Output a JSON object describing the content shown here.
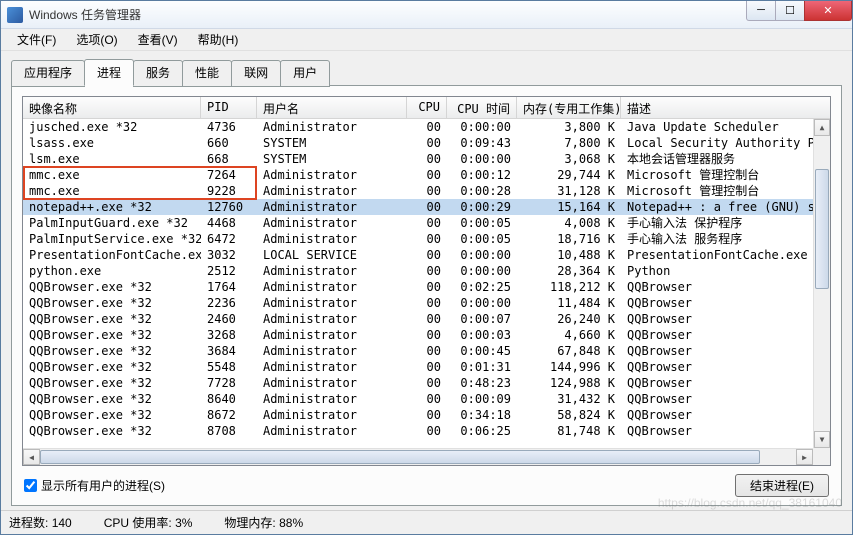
{
  "title": "Windows 任务管理器",
  "menu": {
    "file": "文件(F)",
    "options": "选项(O)",
    "view": "查看(V)",
    "help": "帮助(H)"
  },
  "tabs": {
    "apps": "应用程序",
    "processes": "进程",
    "services": "服务",
    "performance": "性能",
    "networking": "联网",
    "users": "用户"
  },
  "columns": {
    "image_name": "映像名称",
    "pid": "PID",
    "user": "用户名",
    "cpu": "CPU",
    "cpu_time": "CPU 时间",
    "memory": "内存(专用工作集)",
    "description": "描述"
  },
  "rows": [
    {
      "name": "jusched.exe *32",
      "pid": "4736",
      "user": "Administrator",
      "cpu": "00",
      "cputime": "0:00:00",
      "mem": "3,800 K",
      "desc": "Java Update Scheduler",
      "selected": false,
      "highlight": false
    },
    {
      "name": "lsass.exe",
      "pid": "660",
      "user": "SYSTEM",
      "cpu": "00",
      "cputime": "0:09:43",
      "mem": "7,800 K",
      "desc": "Local Security Authority Pro",
      "selected": false,
      "highlight": false
    },
    {
      "name": "lsm.exe",
      "pid": "668",
      "user": "SYSTEM",
      "cpu": "00",
      "cputime": "0:00:00",
      "mem": "3,068 K",
      "desc": "本地会话管理器服务",
      "selected": false,
      "highlight": false
    },
    {
      "name": "mmc.exe",
      "pid": "7264",
      "user": "Administrator",
      "cpu": "00",
      "cputime": "0:00:12",
      "mem": "29,744 K",
      "desc": "Microsoft 管理控制台",
      "selected": false,
      "highlight": true
    },
    {
      "name": "mmc.exe",
      "pid": "9228",
      "user": "Administrator",
      "cpu": "00",
      "cputime": "0:00:28",
      "mem": "31,128 K",
      "desc": "Microsoft 管理控制台",
      "selected": false,
      "highlight": true
    },
    {
      "name": "notepad++.exe *32",
      "pid": "12760",
      "user": "Administrator",
      "cpu": "00",
      "cputime": "0:00:29",
      "mem": "15,164 K",
      "desc": "Notepad++ : a free (GNU) sou",
      "selected": true,
      "highlight": false
    },
    {
      "name": "PalmInputGuard.exe *32",
      "pid": "4468",
      "user": "Administrator",
      "cpu": "00",
      "cputime": "0:00:05",
      "mem": "4,008 K",
      "desc": "手心输入法 保护程序",
      "selected": false,
      "highlight": false
    },
    {
      "name": "PalmInputService.exe *32",
      "pid": "6472",
      "user": "Administrator",
      "cpu": "00",
      "cputime": "0:00:05",
      "mem": "18,716 K",
      "desc": "手心输入法 服务程序",
      "selected": false,
      "highlight": false
    },
    {
      "name": "PresentationFontCache.exe",
      "pid": "3032",
      "user": "LOCAL SERVICE",
      "cpu": "00",
      "cputime": "0:00:00",
      "mem": "10,488 K",
      "desc": "PresentationFontCache.exe",
      "selected": false,
      "highlight": false
    },
    {
      "name": "python.exe",
      "pid": "2512",
      "user": "Administrator",
      "cpu": "00",
      "cputime": "0:00:00",
      "mem": "28,364 K",
      "desc": "Python",
      "selected": false,
      "highlight": false
    },
    {
      "name": "QQBrowser.exe *32",
      "pid": "1764",
      "user": "Administrator",
      "cpu": "00",
      "cputime": "0:02:25",
      "mem": "118,212 K",
      "desc": "QQBrowser",
      "selected": false,
      "highlight": false
    },
    {
      "name": "QQBrowser.exe *32",
      "pid": "2236",
      "user": "Administrator",
      "cpu": "00",
      "cputime": "0:00:00",
      "mem": "11,484 K",
      "desc": "QQBrowser",
      "selected": false,
      "highlight": false
    },
    {
      "name": "QQBrowser.exe *32",
      "pid": "2460",
      "user": "Administrator",
      "cpu": "00",
      "cputime": "0:00:07",
      "mem": "26,240 K",
      "desc": "QQBrowser",
      "selected": false,
      "highlight": false
    },
    {
      "name": "QQBrowser.exe *32",
      "pid": "3268",
      "user": "Administrator",
      "cpu": "00",
      "cputime": "0:00:03",
      "mem": "4,660 K",
      "desc": "QQBrowser",
      "selected": false,
      "highlight": false
    },
    {
      "name": "QQBrowser.exe *32",
      "pid": "3684",
      "user": "Administrator",
      "cpu": "00",
      "cputime": "0:00:45",
      "mem": "67,848 K",
      "desc": "QQBrowser",
      "selected": false,
      "highlight": false
    },
    {
      "name": "QQBrowser.exe *32",
      "pid": "5548",
      "user": "Administrator",
      "cpu": "00",
      "cputime": "0:01:31",
      "mem": "144,996 K",
      "desc": "QQBrowser",
      "selected": false,
      "highlight": false
    },
    {
      "name": "QQBrowser.exe *32",
      "pid": "7728",
      "user": "Administrator",
      "cpu": "00",
      "cputime": "0:48:23",
      "mem": "124,988 K",
      "desc": "QQBrowser",
      "selected": false,
      "highlight": false
    },
    {
      "name": "QQBrowser.exe *32",
      "pid": "8640",
      "user": "Administrator",
      "cpu": "00",
      "cputime": "0:00:09",
      "mem": "31,432 K",
      "desc": "QQBrowser",
      "selected": false,
      "highlight": false
    },
    {
      "name": "QQBrowser.exe *32",
      "pid": "8672",
      "user": "Administrator",
      "cpu": "00",
      "cputime": "0:34:18",
      "mem": "58,824 K",
      "desc": "QQBrowser",
      "selected": false,
      "highlight": false
    },
    {
      "name": "QQBrowser.exe *32",
      "pid": "8708",
      "user": "Administrator",
      "cpu": "00",
      "cputime": "0:06:25",
      "mem": "81,748 K",
      "desc": "QQBrowser",
      "selected": false,
      "highlight": false
    }
  ],
  "bottom": {
    "show_all": "显示所有用户的进程(S)",
    "end_process": "结束进程(E)"
  },
  "status": {
    "process_count_label": "进程数:",
    "process_count": "140",
    "cpu_label": "CPU 使用率:",
    "cpu_value": "3%",
    "mem_label": "物理内存:",
    "mem_value": "88%"
  },
  "watermark": "https://blog.csdn.net/qq_38161040"
}
